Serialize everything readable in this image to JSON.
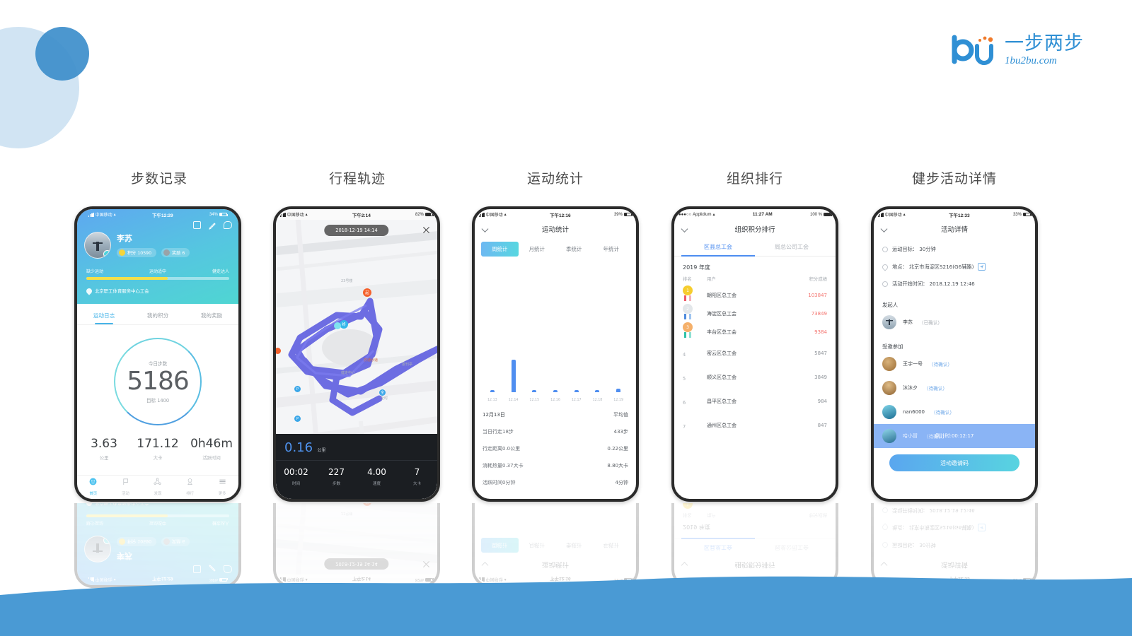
{
  "brand": {
    "cn": "一步两步",
    "en": "1bu2bu.com",
    "mark": "bu-logo-icon",
    "color": "#2f8fd4"
  },
  "captions": [
    {
      "label": "步数记录"
    },
    {
      "label": "行程轨迹"
    },
    {
      "label": "运动统计"
    },
    {
      "label": "组织排行"
    },
    {
      "label": "健步活动详情"
    }
  ],
  "phone1": {
    "status": {
      "carrier": "中国移动",
      "time": "下午12:29",
      "battery": "34%"
    },
    "actions": [
      "card-icon",
      "pen-icon",
      "chat-icon"
    ],
    "user": {
      "name": "李苏",
      "points_chip": "积分 10590",
      "medal_chip": "奖励 6"
    },
    "progress": {
      "left": "缺少运动",
      "mid": "运动适中",
      "right": "健走达人",
      "percent": 57
    },
    "org": "北京职工体育服务中心工会",
    "tabs": [
      {
        "label": "运动日志",
        "active": true
      },
      {
        "label": "我的积分",
        "active": false
      },
      {
        "label": "我的奖励",
        "active": false
      }
    ],
    "ring": {
      "top_label": "今日步数",
      "steps": "5186",
      "bottom_label": "目标 1400"
    },
    "stats": [
      {
        "value": "3.63",
        "unit": "公里"
      },
      {
        "value": "171.12",
        "unit": "大卡"
      },
      {
        "value": "0h46m",
        "unit": "活跃时间"
      }
    ],
    "nav": [
      {
        "label": "首页",
        "icon": "smiley-icon",
        "active": true
      },
      {
        "label": "活动",
        "icon": "flag-icon",
        "active": false
      },
      {
        "label": "发现",
        "icon": "share-icon",
        "active": false
      },
      {
        "label": "排行",
        "icon": "ranking-icon",
        "active": false
      },
      {
        "label": "更多",
        "icon": "menu-icon",
        "active": false
      }
    ]
  },
  "phone2": {
    "status": {
      "carrier": "中国移动",
      "time": "下午2:14",
      "battery": "82%"
    },
    "pill": "2018-12-19 14:14",
    "close": "close-icon",
    "map_labels": [
      "23号楼",
      "苏通炒道",
      "报刊亭",
      "健走中心",
      "全时"
    ],
    "markers": {
      "start": "起",
      "end": "终"
    },
    "distance": {
      "value": "0.16",
      "unit": "公里"
    },
    "cells": [
      {
        "value": "00:02",
        "unit": "时间"
      },
      {
        "value": "227",
        "unit": "步数"
      },
      {
        "value": "4.00",
        "unit": "速度"
      },
      {
        "value": "7",
        "unit": "大卡"
      }
    ]
  },
  "phone3": {
    "status": {
      "carrier": "中国移动",
      "time": "下午12:16",
      "battery": "39%"
    },
    "title": "运动统计",
    "tabs": [
      {
        "label": "周统计",
        "active": true
      },
      {
        "label": "月统计",
        "active": false
      },
      {
        "label": "季统计",
        "active": false
      },
      {
        "label": "年统计",
        "active": false
      }
    ],
    "rows": [
      {
        "left": "12月13日",
        "right": "平均值",
        "head": true
      },
      {
        "left": "当日行走18步",
        "right": "433步"
      },
      {
        "left": "行走距离0.0公里",
        "right": "0.22公里"
      },
      {
        "left": "消耗热量0.37大卡",
        "right": "8.80大卡"
      },
      {
        "left": "活跃时间0分钟",
        "right": "4分钟"
      }
    ]
  },
  "phone4": {
    "status": {
      "carrier": "Applidium",
      "time": "11:27 AM",
      "battery": "100 %"
    },
    "title": "组织积分排行",
    "tabs": [
      {
        "label": "区县总工会",
        "active": true
      },
      {
        "label": "局总公司工会",
        "active": false
      }
    ],
    "year": "2019 年度",
    "headers": {
      "rank": "排名",
      "user": "用户",
      "score": "积分成绩"
    },
    "rows": [
      {
        "rank": "1",
        "user": "朝阳区总工会",
        "score": "103847",
        "medal": "gold"
      },
      {
        "rank": "2",
        "user": "海淀区总工会",
        "score": "73849",
        "medal": "silver"
      },
      {
        "rank": "3",
        "user": "丰台区总工会",
        "score": "9384",
        "medal": "bronze"
      },
      {
        "rank": "4",
        "user": "密云区总工会",
        "score": "5847",
        "medal": ""
      },
      {
        "rank": "5",
        "user": "顺义区总工会",
        "score": "3849",
        "medal": ""
      },
      {
        "rank": "6",
        "user": "昌平区总工会",
        "score": "984",
        "medal": ""
      },
      {
        "rank": "7",
        "user": "通州区总工会",
        "score": "847",
        "medal": ""
      }
    ]
  },
  "phone5": {
    "status": {
      "carrier": "中国移动",
      "time": "下午12:33",
      "battery": "33%"
    },
    "title": "活动详情",
    "info": [
      {
        "icon": "clock-icon",
        "text": "运动目标： 30分钟"
      },
      {
        "icon": "location-icon",
        "text": "地点： 北京市海淀区S216(G6辅路)",
        "badge": "navigate-icon"
      },
      {
        "icon": "clock-icon",
        "text": "活动开始时间： 2018.12.19 12:46"
      }
    ],
    "initiator_section": "发起人",
    "initiator": {
      "name": "李苏",
      "status": "（已确认）"
    },
    "invited_section": "受邀参加",
    "invited": [
      {
        "name": "王宇一号",
        "status": "（待确认）"
      },
      {
        "name": "沐沐夕",
        "status": "（待确认）"
      },
      {
        "name": "nan6000",
        "status": "（待确认）"
      },
      {
        "name": "哈小冒",
        "status": "（待确认）"
      }
    ],
    "highlight": "倒计时:00:12:17",
    "cta": "活动邀请码"
  }
}
